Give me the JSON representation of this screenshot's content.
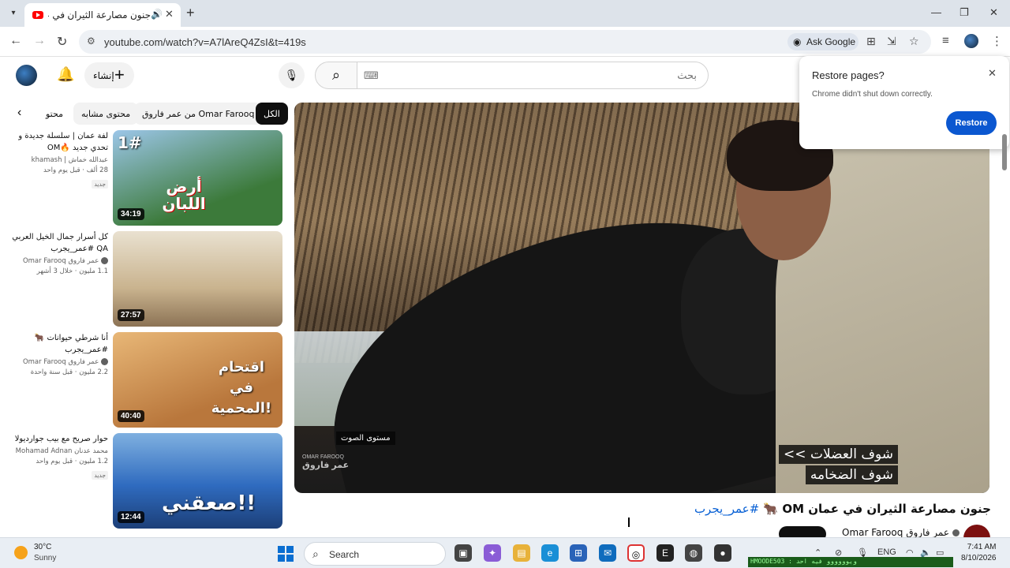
{
  "browser": {
    "tab_title": "جنون مصارعة الثيران في عمان",
    "new_tab": "+",
    "url": "youtube.com/watch?v=A7lAreQ4ZsI&t=419s",
    "ask_google": "Ask Google"
  },
  "youtube": {
    "create_label": "إنشاء",
    "search_placeholder": "بحث",
    "chips": [
      "الكل",
      "من عمر فاروق Omar Farooq",
      "محتوى مشابه",
      "محتو"
    ]
  },
  "restore_popup": {
    "title": "Restore pages?",
    "subtitle": "Chrome didn't shut down correctly.",
    "button": "Restore"
  },
  "player": {
    "overlay_label": "مستوى الصوت",
    "watermark_top": "OMAR FAROOQ",
    "watermark_bottom": "عمر فاروق",
    "subtitle_line1": "<< شوف العضلات",
    "subtitle_line2": "شوف الضخامه"
  },
  "video": {
    "title": "جنون مصارعة الثيران في عمان",
    "emoji": "🐂",
    "flag": "OM",
    "hashtag": "#عمر_يجرب",
    "channel": "عمر فاروق Omar Farooq"
  },
  "recommendations": [
    {
      "title": "لفة عمان | سلسلة جديدة و تحدي جديد 🔥OM",
      "channel": "عبدالله خماش | khamash",
      "stats": "28 ألف · قبل يوم واحد",
      "new_badge": "جديد",
      "duration": "34:19",
      "thumb_text": "أرض اللبان",
      "thumb_number": "1#",
      "thumb_colors": [
        "#3c7a3a",
        "#9cc6e8"
      ]
    },
    {
      "title": "كل أسرار جمال الخيل العربي QA #عمر_يجرب",
      "channel": "عمر فاروق Omar Farooq",
      "stats": "1.1 مليون · خلال 3 أشهر",
      "new_badge": "",
      "duration": "27:57",
      "thumb_text": "",
      "thumb_number": "",
      "thumb_colors": [
        "#c9b38e",
        "#e9e1d0"
      ]
    },
    {
      "title": "أنا شرطي حيوانات 🐂 #عمر_يجرب",
      "channel": "عمر فاروق Omar Farooq",
      "stats": "2.2 مليون · قبل سنة واحدة",
      "new_badge": "",
      "duration": "40:40",
      "thumb_text": "اقتحام في المحمية!",
      "thumb_number": "",
      "thumb_colors": [
        "#b9773c",
        "#e8b777"
      ]
    },
    {
      "title": "حوار صريح مع بيب جوارديولا",
      "channel": "محمد عدنان Mohamad Adnan",
      "stats": "1.2 مليون · قبل يوم واحد",
      "new_badge": "جديد",
      "duration": "12:44",
      "thumb_text": "صعقني!!",
      "thumb_number": "",
      "thumb_colors": [
        "#2f6bbf",
        "#7fb0e0"
      ]
    }
  ],
  "taskbar": {
    "temperature": "30°C",
    "weather": "Sunny",
    "search": "Search",
    "language": "ENG",
    "time": "7:41 AM",
    "date": "8/10/2026",
    "notification_text": "HMOODE503 : ويوووووو فيه احد"
  },
  "colors": {
    "accent_blue": "#0b57d0",
    "youtube_red": "#ff0000",
    "hashtag_blue": "#065fd4"
  }
}
